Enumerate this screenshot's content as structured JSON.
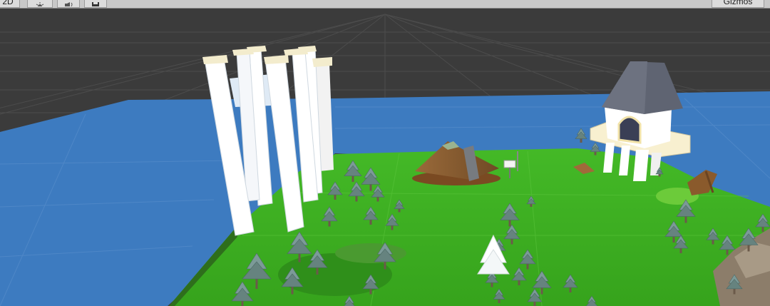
{
  "toolbar": {
    "mode_2d_label": "2D",
    "gizmos_label": "Gizmos",
    "lighting_icon": "sun-icon",
    "audio_icon": "speaker-icon",
    "effects_icon": "image-icon"
  },
  "colors": {
    "editor_background": "#3a3a3a",
    "grid_line": "#4e4e4e",
    "water": "#3d7bc0",
    "grass": "#3fb221",
    "tree": "#6f8f8c",
    "pillar": "#ffffff",
    "roof": "#5f6472",
    "volcano": "#8b5a2b"
  }
}
